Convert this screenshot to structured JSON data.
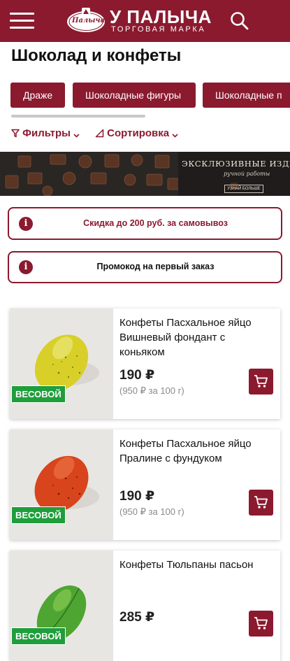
{
  "header": {
    "logo_badge": "Палыча",
    "logo_title": "У ПАЛЫЧА",
    "logo_subtitle": "ТОРГОВАЯ МАРКА",
    "menu_icon": "hamburger-icon",
    "search_icon": "search-icon"
  },
  "page": {
    "title": "Шоколад и конфеты"
  },
  "categories": [
    "Драже",
    "Шоколадные фигуры",
    "Шоколадные п"
  ],
  "category_scroll_fraction": 0.5,
  "toolbar": {
    "filters_label": "Фильтры",
    "sort_label": "Сортировка"
  },
  "banner": {
    "title": "ЭКСКЛЮЗИВНЫЕ ИЗДЕЛИЯ",
    "subtitle": "ручной работы",
    "button": "УЗНАЙ БОЛЬШЕ"
  },
  "promos": [
    {
      "text": "Скидка до 200 руб. за самовывоз",
      "icon": "info-icon"
    },
    {
      "text": "Промокод на первый заказ",
      "icon": "info-icon"
    }
  ],
  "products": [
    {
      "name": "Конфеты Пасхальное яйцо Вишневый фондант с коньяком",
      "price": "190 ₽",
      "unit_price": "(950 ₽ за 100 г)",
      "badge": "ВЕСОВОЙ",
      "egg_color": "#d9d12a"
    },
    {
      "name": "Конфеты Пасхальное яйцо Пралине с фундуком",
      "price": "190 ₽",
      "unit_price": "(950 ₽ за 100 г)",
      "badge": "ВЕСОВОЙ",
      "egg_color": "#d9441c"
    },
    {
      "name": "Конфеты Тюльпаны пасьон",
      "price": "285 ₽",
      "unit_price": "",
      "badge": "ВЕСОВОЙ",
      "egg_color": "#4fa531"
    }
  ],
  "colors": {
    "brand": "#8b1a2f",
    "badge_green": "#1f9e3b"
  }
}
